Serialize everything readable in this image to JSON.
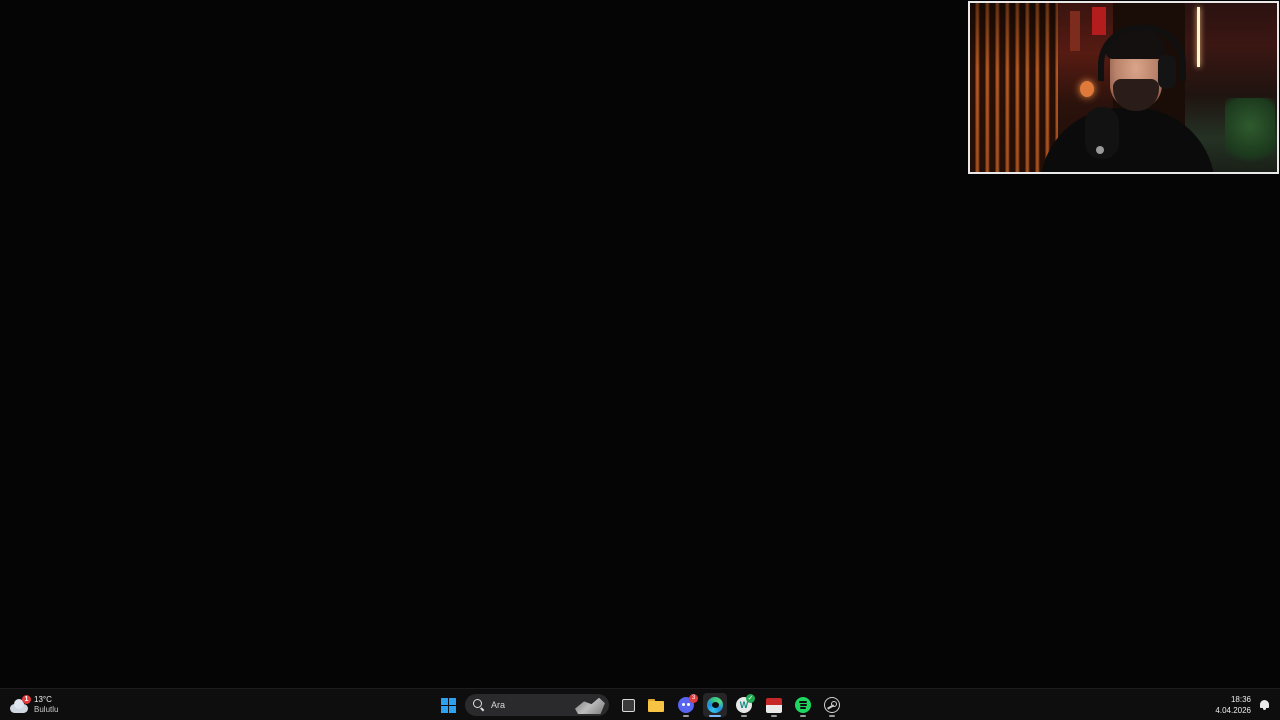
{
  "webcam": {
    "label": "streamer webcam overlay"
  },
  "taskbar": {
    "weather": {
      "temperature": "13°C",
      "condition": "Bulutlu",
      "alert_count": "1",
      "icon": "cloud-icon"
    },
    "search": {
      "placeholder": "Ara"
    },
    "apps": [
      {
        "name": "Start",
        "icon": "windows-logo-icon"
      },
      {
        "name": "Task View",
        "icon": "task-view-icon"
      },
      {
        "name": "File Explorer",
        "icon": "folder-icon"
      },
      {
        "name": "Discord",
        "icon": "discord-icon",
        "badge": "3"
      },
      {
        "name": "Microsoft Edge",
        "icon": "edge-icon",
        "active": true
      },
      {
        "name": "WhatsApp",
        "icon": "whatsapp-icon"
      },
      {
        "name": "Streaming app",
        "icon": "stream-app-icon"
      },
      {
        "name": "Spotify",
        "icon": "spotify-icon"
      },
      {
        "name": "Steam",
        "icon": "steam-icon"
      }
    ],
    "clock": {
      "time": "18:36",
      "date": "4.04.2026"
    }
  },
  "colors": {
    "desktop_bg": "#050505",
    "taskbar_bg": "#0e0e0f",
    "accent": "#78b8ff",
    "windows_blue": "#2ea0f0"
  }
}
